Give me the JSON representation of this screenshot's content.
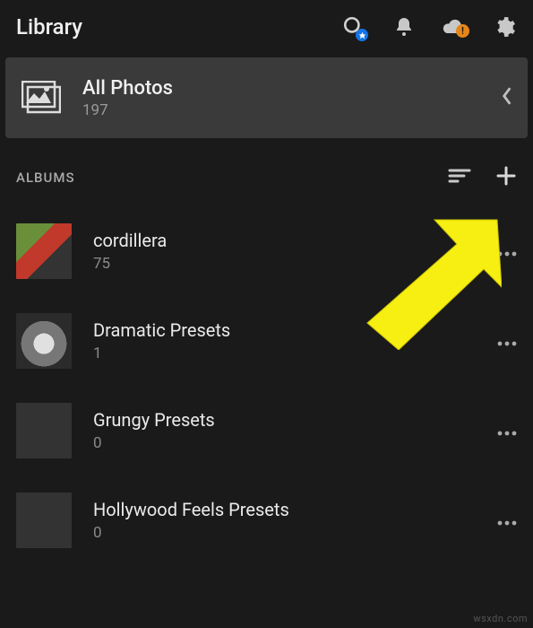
{
  "header": {
    "title": "Library"
  },
  "allPhotos": {
    "label": "All Photos",
    "count": "197"
  },
  "section": {
    "label": "ALBUMS"
  },
  "albums": [
    {
      "name": "cordillera",
      "count": "75"
    },
    {
      "name": "Dramatic Presets",
      "count": "1"
    },
    {
      "name": "Grungy Presets",
      "count": "0"
    },
    {
      "name": "Hollywood Feels Presets",
      "count": "0"
    }
  ],
  "watermark": "wsxdn.com",
  "colors": {
    "blue": "#1473e6",
    "orange": "#e68619",
    "yellow": "#f7ef12"
  }
}
